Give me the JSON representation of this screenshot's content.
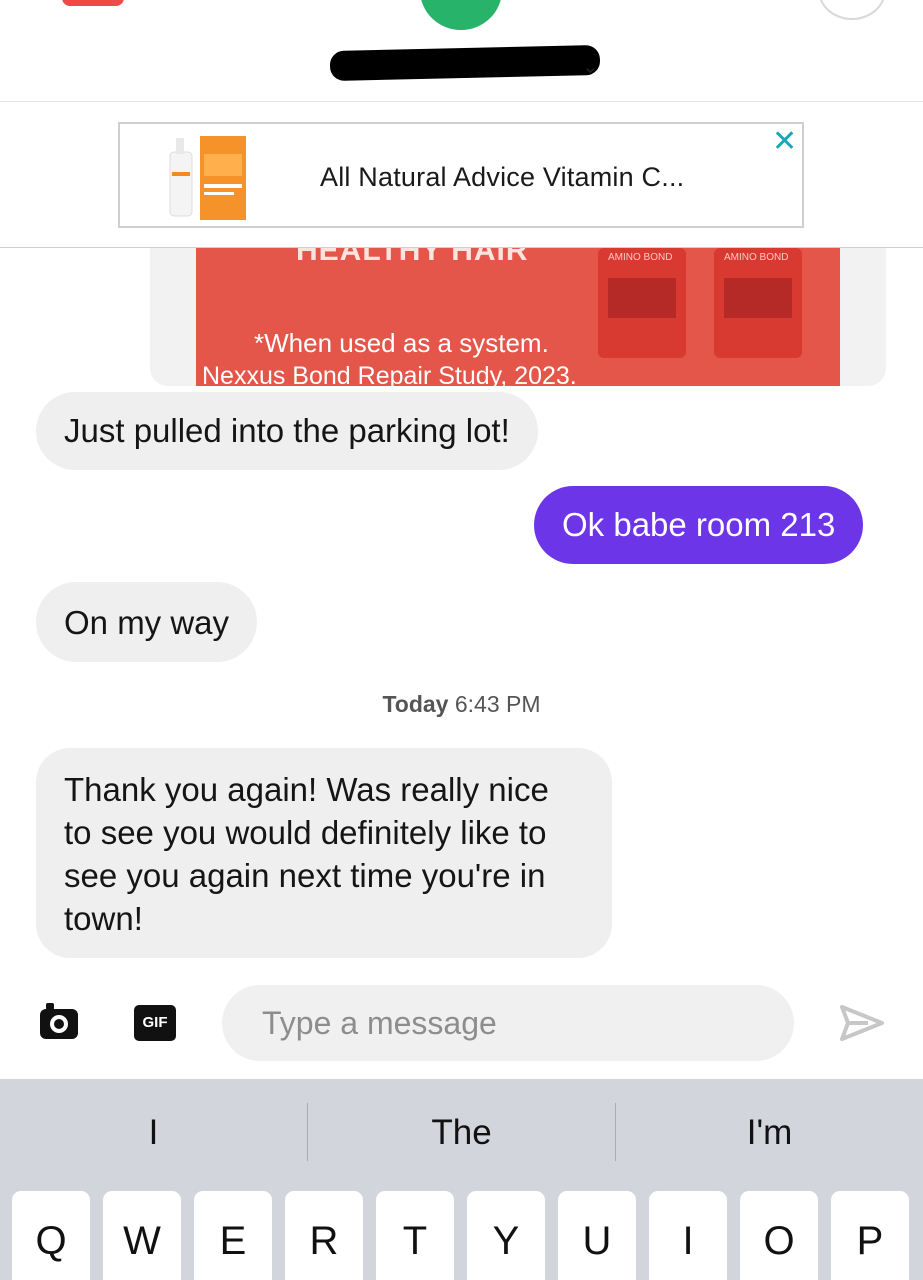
{
  "ad": {
    "title": "All Natural Advice Vitamin C...",
    "close_glyph": "✕"
  },
  "shared_media": {
    "headline": "HEALTHY HAIR",
    "footnote": "*When used as a system.",
    "source": "Nexxus Bond Repair Study, 2023."
  },
  "messages": [
    {
      "direction": "incoming",
      "text": "Just pulled into the parking lot!"
    },
    {
      "direction": "outgoing",
      "text": "Ok babe room 213"
    },
    {
      "direction": "incoming",
      "text": "On my way"
    },
    {
      "direction": "incoming",
      "text": "Thank you again! Was really nice to see you would definitely like to see you again next time you're in town!"
    }
  ],
  "timestamp": {
    "day": "Today",
    "time": "6:43 PM"
  },
  "composer": {
    "gif_label": "GIF",
    "placeholder": "Type a message"
  },
  "keyboard": {
    "suggestions": [
      "I",
      "The",
      "I'm"
    ],
    "row1": [
      "Q",
      "W",
      "E",
      "R",
      "T",
      "Y",
      "U",
      "I",
      "O",
      "P"
    ]
  },
  "colors": {
    "outgoing_bubble": "#6d35e8",
    "incoming_bubble": "#efefef",
    "ad_close": "#14a8b8",
    "keyboard_bg": "#d2d5db"
  }
}
